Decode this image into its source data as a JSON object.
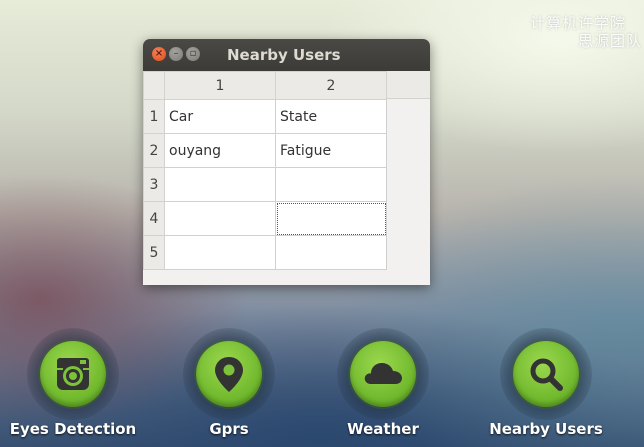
{
  "watermark": {
    "line1": "计算机许学院",
    "line2": "思源团队"
  },
  "window": {
    "title": "Nearby Users",
    "controls": {
      "close": "×",
      "minimize": "–",
      "maximize": "▫"
    }
  },
  "table": {
    "column_headers": [
      "1",
      "2"
    ],
    "row_headers": [
      "1",
      "2",
      "3",
      "4",
      "5"
    ],
    "rows": [
      [
        "Car",
        "State"
      ],
      [
        "ouyang",
        "Fatigue"
      ],
      [
        "",
        ""
      ],
      [
        "",
        ""
      ],
      [
        "",
        ""
      ]
    ]
  },
  "dock": {
    "items": [
      {
        "label": "Eyes Detection",
        "icon": "camera-icon"
      },
      {
        "label": "Gprs",
        "icon": "map-pin-icon"
      },
      {
        "label": "Weather",
        "icon": "cloud-icon"
      },
      {
        "label": "Nearby Users",
        "icon": "search-icon"
      }
    ],
    "icon_color": "#7cc23a"
  }
}
